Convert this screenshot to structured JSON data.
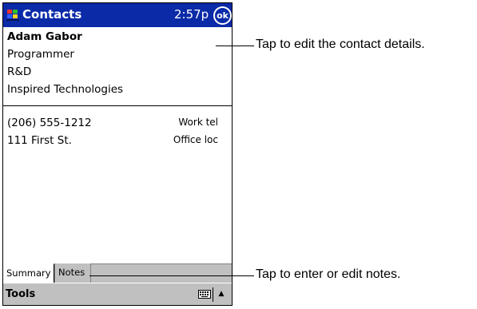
{
  "titlebar": {
    "app_title": "Contacts",
    "time": "2:57p",
    "ok_label": "ok",
    "start_icon": "windows-flag-icon"
  },
  "contact": {
    "name": "Adam Gabor",
    "title": "Programmer",
    "department": "R&D",
    "company": "Inspired Technologies"
  },
  "fields": [
    {
      "value": "(206) 555-1212",
      "label": "Work tel"
    },
    {
      "value": "111 First St.",
      "label": "Office loc"
    }
  ],
  "tabs": [
    {
      "label": "Summary",
      "active": true
    },
    {
      "label": "Notes",
      "active": false
    }
  ],
  "menubar": {
    "tools_label": "Tools",
    "keyboard_icon": "keyboard-icon",
    "sip_arrow": "▲"
  },
  "callouts": {
    "details": "Tap to edit the contact details.",
    "notes": "Tap to enter or edit notes."
  },
  "colors": {
    "titlebar_bg": "#0a2aa8",
    "chrome_gray": "#c0c0c0"
  }
}
